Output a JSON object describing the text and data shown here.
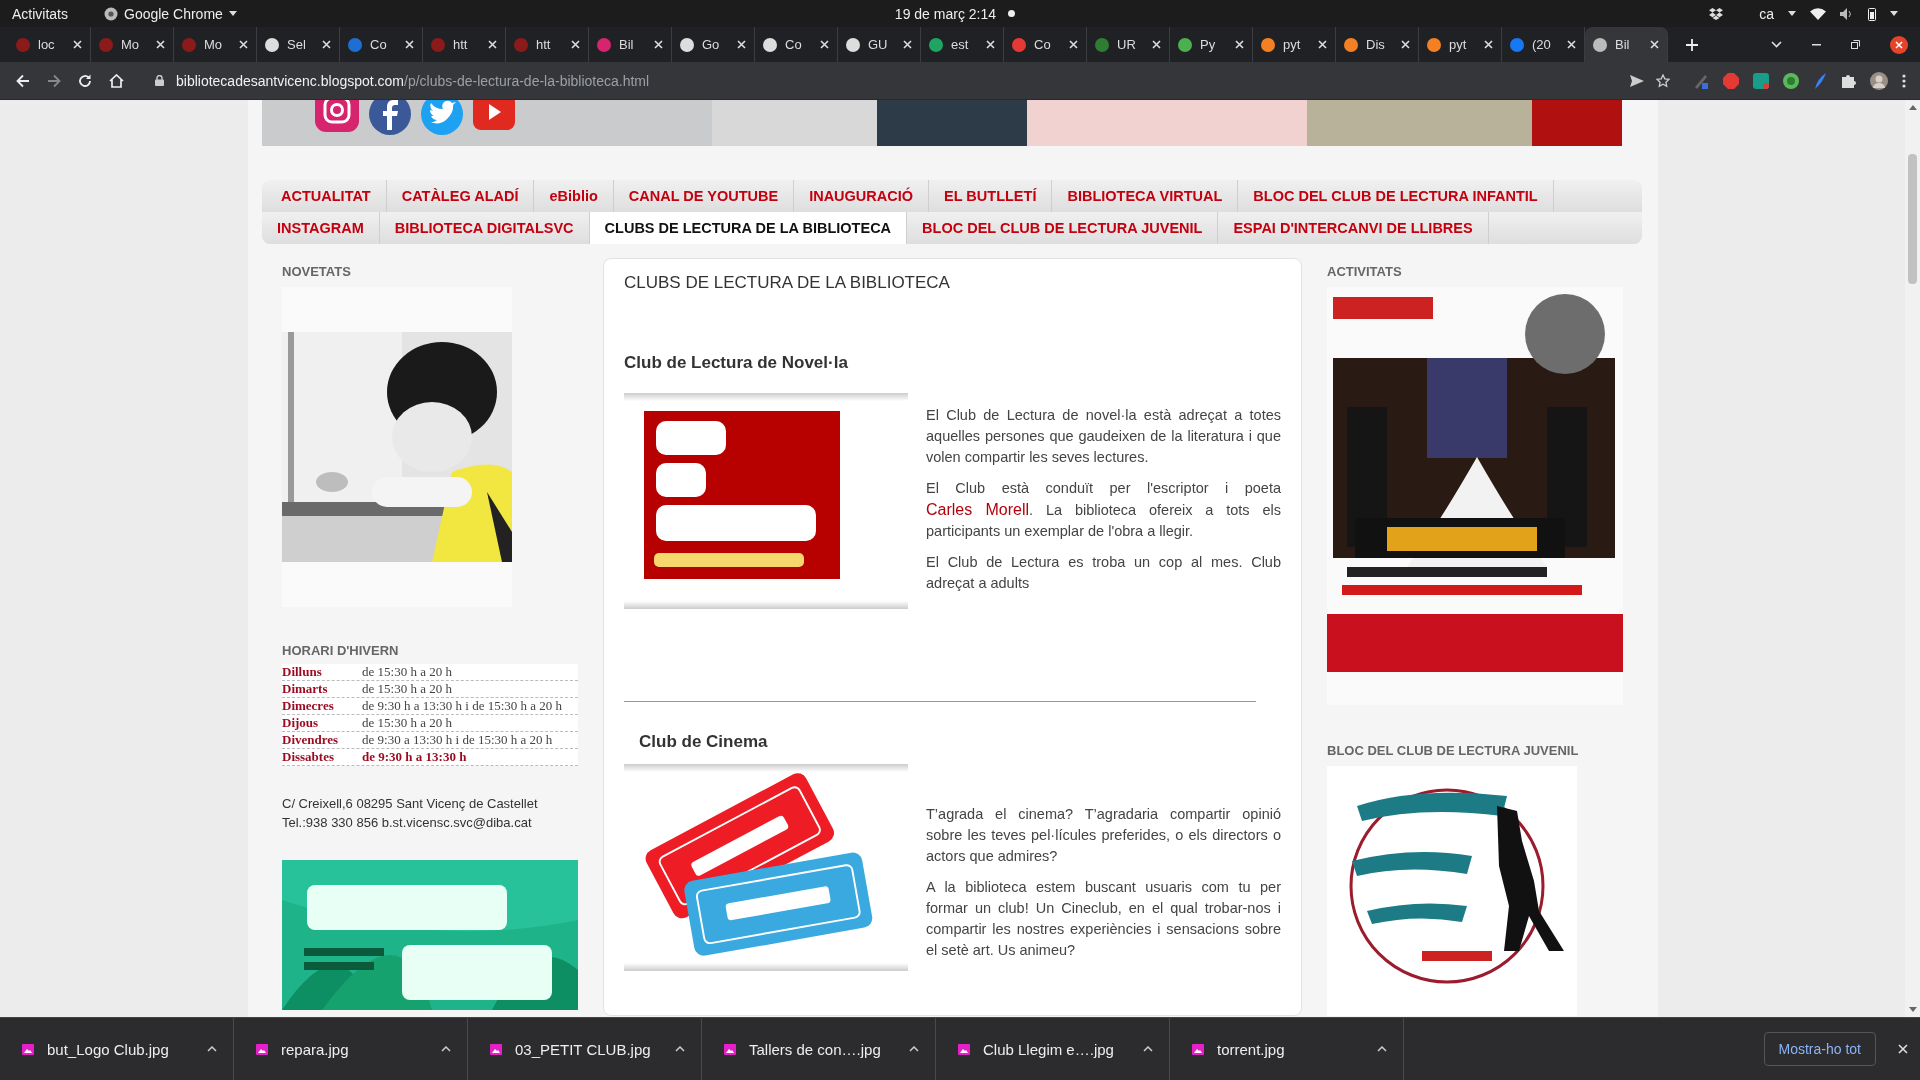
{
  "system_bar": {
    "activities": "Activitats",
    "app": "Google Chrome",
    "clock": "19 de març  2:14",
    "language": "ca"
  },
  "browser": {
    "tabs": [
      {
        "title": "loc",
        "color": "#8b1a1a",
        "selected": false
      },
      {
        "title": "Mo",
        "color": "#8b1a1a",
        "selected": false
      },
      {
        "title": "Mo",
        "color": "#8b1a1a",
        "selected": false
      },
      {
        "title": "Sel",
        "color": "#dddddd",
        "selected": false
      },
      {
        "title": "Co",
        "color": "#1e6fd1",
        "selected": false
      },
      {
        "title": "htt",
        "color": "#8b1a1a",
        "selected": false
      },
      {
        "title": "htt",
        "color": "#8b1a1a",
        "selected": false
      },
      {
        "title": "Bil",
        "color": "#d6246e",
        "selected": false
      },
      {
        "title": "Go",
        "color": "#dddddd",
        "selected": false
      },
      {
        "title": "Co",
        "color": "#dddddd",
        "selected": false
      },
      {
        "title": "GU",
        "color": "#dddddd",
        "selected": false
      },
      {
        "title": "est",
        "color": "#1fa463",
        "selected": false
      },
      {
        "title": "Co",
        "color": "#e53935",
        "selected": false
      },
      {
        "title": "UR",
        "color": "#2e7d32",
        "selected": false
      },
      {
        "title": "Py",
        "color": "#4caf50",
        "selected": false
      },
      {
        "title": "pyt",
        "color": "#f48024",
        "selected": false
      },
      {
        "title": "Dis",
        "color": "#f48024",
        "selected": false
      },
      {
        "title": "pyt",
        "color": "#f48024",
        "selected": false
      },
      {
        "title": "(20",
        "color": "#1877f2",
        "selected": false
      },
      {
        "title": "Bil",
        "color": "#bbbbbb",
        "selected": true
      }
    ],
    "url_host": "bibliotecadesantvicenc.blogspot.com",
    "url_path": "/p/clubs-de-lectura-de-la-biblioteca.html"
  },
  "nav": {
    "items": [
      {
        "label": "ACTUALITAT",
        "selected": false
      },
      {
        "label": "CATÀLEG ALADÍ",
        "selected": false
      },
      {
        "label": "eBiblio",
        "selected": false
      },
      {
        "label": "CANAL DE YOUTUBE",
        "selected": false
      },
      {
        "label": "INAUGURACIÓ",
        "selected": false
      },
      {
        "label": "EL BUTLLETÍ",
        "selected": false
      },
      {
        "label": "BIBLIOTECA VIRTUAL",
        "selected": false
      },
      {
        "label": "BLOC DEL CLUB DE LECTURA INFANTIL",
        "selected": false
      },
      {
        "label": "INSTAGRAM",
        "selected": false
      },
      {
        "label": "BIBLIOTECA DIGITALSVC",
        "selected": false
      },
      {
        "label": "CLUBS DE LECTURA DE LA BIBLIOTECA",
        "selected": true
      },
      {
        "label": "BLOC DEL CLUB DE LECTURA JUVENIL",
        "selected": false
      },
      {
        "label": "ESPAI D'INTERCANVI DE LLIBRES",
        "selected": false
      }
    ]
  },
  "left": {
    "novetats_title": "NOVETATS",
    "hours_title": "HORARI D'HIVERN",
    "hours": [
      {
        "day": "Dilluns",
        "time": "de 15:30 h a 20 h",
        "highlight": false
      },
      {
        "day": "Dimarts",
        "time": "de 15:30 h a 20 h",
        "highlight": false
      },
      {
        "day": "Dimecres",
        "time": "de 9:30 h a 13:30 h i de 15:30 h a 20 h",
        "highlight": false
      },
      {
        "day": "Dijous",
        "time": "de 15:30 h a 20 h",
        "highlight": false
      },
      {
        "day": "Divendres",
        "time": "de 9:30 a 13:30 h i de 15:30 h a 20 h",
        "highlight": false
      },
      {
        "day": "Dissabtes",
        "time": "de 9:30 h a 13:30 h",
        "highlight": true
      }
    ],
    "address": "C/ Creixell,6 08295 Sant Vicenç de Castellet",
    "contact": "Tel.:938 330 856 b.st.vicensc.svc@diba.cat"
  },
  "main": {
    "title": "CLUBS DE LECTURA DE LA BIBLIOTECA",
    "sections": [
      {
        "title": "Club de Lectura de Novel·la",
        "kind": "reading",
        "paragraphs": [
          [
            {
              "text": "El Club de Lectura de novel·la està adreçat a totes aquelles persones que gaudeixen de la literatura i  que volen compartir les seves lectures."
            }
          ],
          [
            {
              "text": "El Club  està conduït per l'escriptor i  poeta "
            },
            {
              "text": "Carles Morell",
              "link": true
            },
            {
              "text": ". La biblioteca ofereix a tots els participants un exemplar de l'obra a llegir."
            }
          ],
          [
            {
              "text": "El Club de Lectura es troba un cop al mes. Club adreçat a adults"
            }
          ]
        ]
      },
      {
        "title": "Club de Cinema",
        "kind": "cinema",
        "paragraphs": [
          [
            {
              "text": "T’agrada el cinema? T’agradaria compartir opinió sobre les teves pel·lícules preferides, o els directors o actors que admires?"
            }
          ],
          [
            {
              "text": "A la biblioteca estem buscant usuaris com tu per formar un club! Un Cineclub, en el qual trobar-nos i compartir les nostres experiències i sensacions sobre el setè art. Us animeu?"
            }
          ]
        ]
      }
    ]
  },
  "right": {
    "activities_title": "ACTIVITATS",
    "blog_title": "BLOC DEL CLUB DE LECTURA JUVENIL"
  },
  "downloads": {
    "files": [
      "but_Logo Club.jpg",
      "repara.jpg",
      "03_PETIT CLUB.jpg",
      "Tallers de con….jpg",
      "Club Llegim e….jpg",
      "torrent.jpg"
    ],
    "show_all": "Mostra-ho tot"
  }
}
